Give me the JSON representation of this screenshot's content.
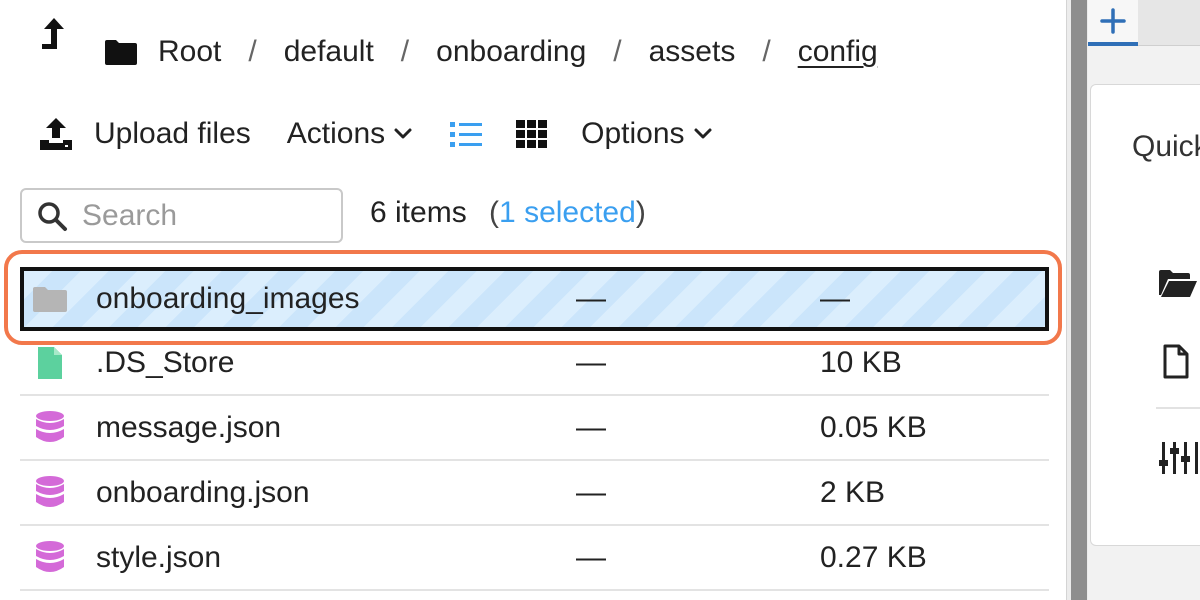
{
  "breadcrumb": {
    "items": [
      "Root",
      "default",
      "onboarding",
      "assets",
      "config"
    ],
    "separator": "/"
  },
  "toolbar": {
    "upload_label": "Upload files",
    "actions_label": "Actions",
    "options_label": "Options"
  },
  "search": {
    "placeholder": "Search"
  },
  "summary": {
    "items_text": "6 items",
    "open_paren": "(",
    "selected_text": "1 selected",
    "close_paren": ")"
  },
  "files": [
    {
      "name": "onboarding_images",
      "modified": "—",
      "size": "—",
      "icon": "folder-icon",
      "selected": true
    },
    {
      "name": ".DS_Store",
      "modified": "—",
      "size": "10 KB",
      "icon": "file-icon"
    },
    {
      "name": "message.json",
      "modified": "—",
      "size": "0.05 KB",
      "icon": "database-icon"
    },
    {
      "name": "onboarding.json",
      "modified": "—",
      "size": "2 KB",
      "icon": "database-icon"
    },
    {
      "name": "style.json",
      "modified": "—",
      "size": "0.27 KB",
      "icon": "database-icon"
    }
  ],
  "right_panel": {
    "title": "Quick"
  },
  "colors": {
    "accent": "#3a9ff0",
    "highlight_outline": "#f2784b",
    "selected_row_bg": "#dbeefd",
    "database_icon": "#d46ad8",
    "file_icon": "#5cd19e",
    "folder_icon_grey": "#b5b5b5",
    "tab_indicator": "#2f6fb7"
  }
}
